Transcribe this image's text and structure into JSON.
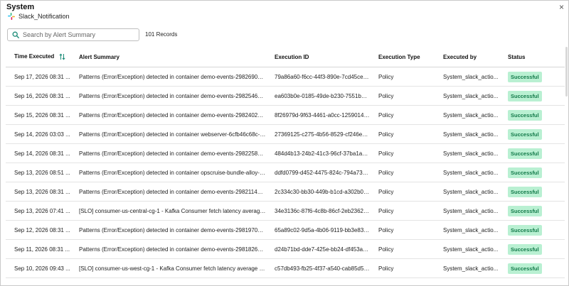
{
  "header": {
    "title": "System",
    "subtitle": "Slack_Notification",
    "close_label": "×"
  },
  "search": {
    "placeholder": "Search by Alert Summary"
  },
  "records_label": "101 Records",
  "colors": {
    "link": "#1b8b77",
    "badge_bg": "#b9f0d2",
    "badge_text": "#137a4a"
  },
  "table": {
    "columns": [
      "Time Executed",
      "Alert Summary",
      "Execution ID",
      "Execution Type",
      "Executed by",
      "Status"
    ],
    "rows": [
      [
        "Sep 17, 2026 08:31 ...",
        "Patterns (Error/Exception) detected in container demo-events-29826900-4...",
        "79a86a60-f6cc-44f3-890e-7cd45ce72789",
        "Policy",
        "System_slack_actio...",
        "Successful"
      ],
      [
        "Sep 16, 2026 08:31 ...",
        "Patterns (Error/Exception) detected in container demo-events-29825460-fj...",
        "ea603b0e-0185-49de-b230-7551b36bb7c",
        "Policy",
        "System_slack_actio...",
        "Successful"
      ],
      [
        "Sep 15, 2026 08:31 ...",
        "Patterns (Error/Exception) detected in container demo-events-29824020-7...",
        "8f26979d-9f63-4461-a0cc-125901496b0b",
        "Policy",
        "System_slack_actio...",
        "Successful"
      ],
      [
        "Sep 14, 2026 03:03 ...",
        "Patterns (Error/Exception) detected in container webserver-6cfb46c68c-qh...",
        "27369125-c275-4b56-8529-cf246ed02ef2",
        "Policy",
        "System_slack_actio...",
        "Successful"
      ],
      [
        "Sep 14, 2026 08:31 ...",
        "Patterns (Error/Exception) detected in container demo-events-29822580-8...",
        "484d4b13-24b2-41c3-96cf-37ba1ad65b5t",
        "Policy",
        "System_slack_actio...",
        "Successful"
      ],
      [
        "Sep 13, 2026 08:51 ...",
        "Patterns (Error/Exception) detected in container opscruise-bundle-alloy-ote...",
        "ddfd0799-d452-4475-824c-794a7380d88:",
        "Policy",
        "System_slack_actio...",
        "Successful"
      ],
      [
        "Sep 13, 2026 08:31 ...",
        "Patterns (Error/Exception) detected in container demo-events-29821140-8t...",
        "2c334c30-bb30-449b-b1cd-a302b0a7de8",
        "Policy",
        "System_slack_actio...",
        "Successful"
      ],
      [
        "Sep 13, 2026 07:41 ...",
        "[SLO] consumer-us-central-cg-1 - Kafka Consumer fetch latency average ti...",
        "34e3136c-87f6-4c8b-86cf-2eb23627945f",
        "Policy",
        "System_slack_actio...",
        "Successful"
      ],
      [
        "Sep 12, 2026 08:31 ...",
        "Patterns (Error/Exception) detected in container demo-events-29819700-g4...",
        "65a89c02-9d5a-4b06-9119-bb3e831d3f5:",
        "Policy",
        "System_slack_actio...",
        "Successful"
      ],
      [
        "Sep 11, 2026 08:31 ...",
        "Patterns (Error/Exception) detected in container demo-events-29818260-hc...",
        "d24b71bd-dde7-425e-bb24-df453ac9012",
        "Policy",
        "System_slack_actio...",
        "Successful"
      ],
      [
        "Sep 10, 2026 09:43 ...",
        "[SLO] consumer-us-west-cg-1 - Kafka Consumer fetch latency average time ...",
        "c57db493-fb25-4f37-a540-cab85d52d9d5",
        "Policy",
        "System_slack_actio...",
        "Successful"
      ]
    ]
  }
}
